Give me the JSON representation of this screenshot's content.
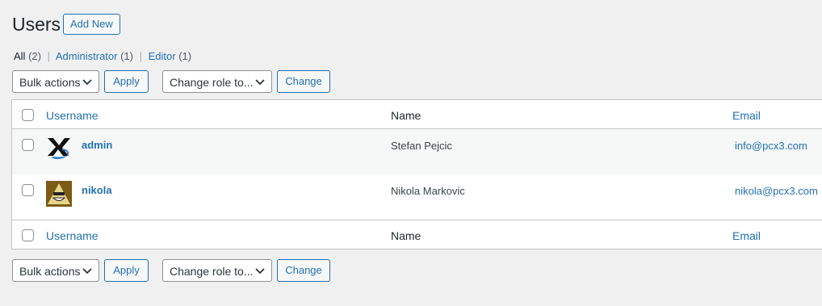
{
  "header": {
    "title": "Users",
    "add_new": "Add New"
  },
  "filters": {
    "all": {
      "label": "All",
      "count": "(2)"
    },
    "administrator": {
      "label": "Administrator",
      "count": "(1)"
    },
    "editor": {
      "label": "Editor",
      "count": "(1)"
    }
  },
  "actions": {
    "bulk": "Bulk actions",
    "apply": "Apply",
    "change_role": "Change role to...",
    "change": "Change"
  },
  "columns": {
    "username": "Username",
    "name": "Name",
    "email": "Email"
  },
  "users": [
    {
      "username": "admin",
      "name": "Stefan Pejcic",
      "email": "info@pcx3.com",
      "avatar_icon": "xs-logo-avatar-icon"
    },
    {
      "username": "nikola",
      "name": "Nikola Markovic",
      "email": "nikola@pcx3.com",
      "avatar_icon": "pyramid-face-avatar-icon"
    }
  ],
  "colors": {
    "link": "#2271b1",
    "background": "#f0f0f1",
    "border": "#c3c4c7"
  }
}
